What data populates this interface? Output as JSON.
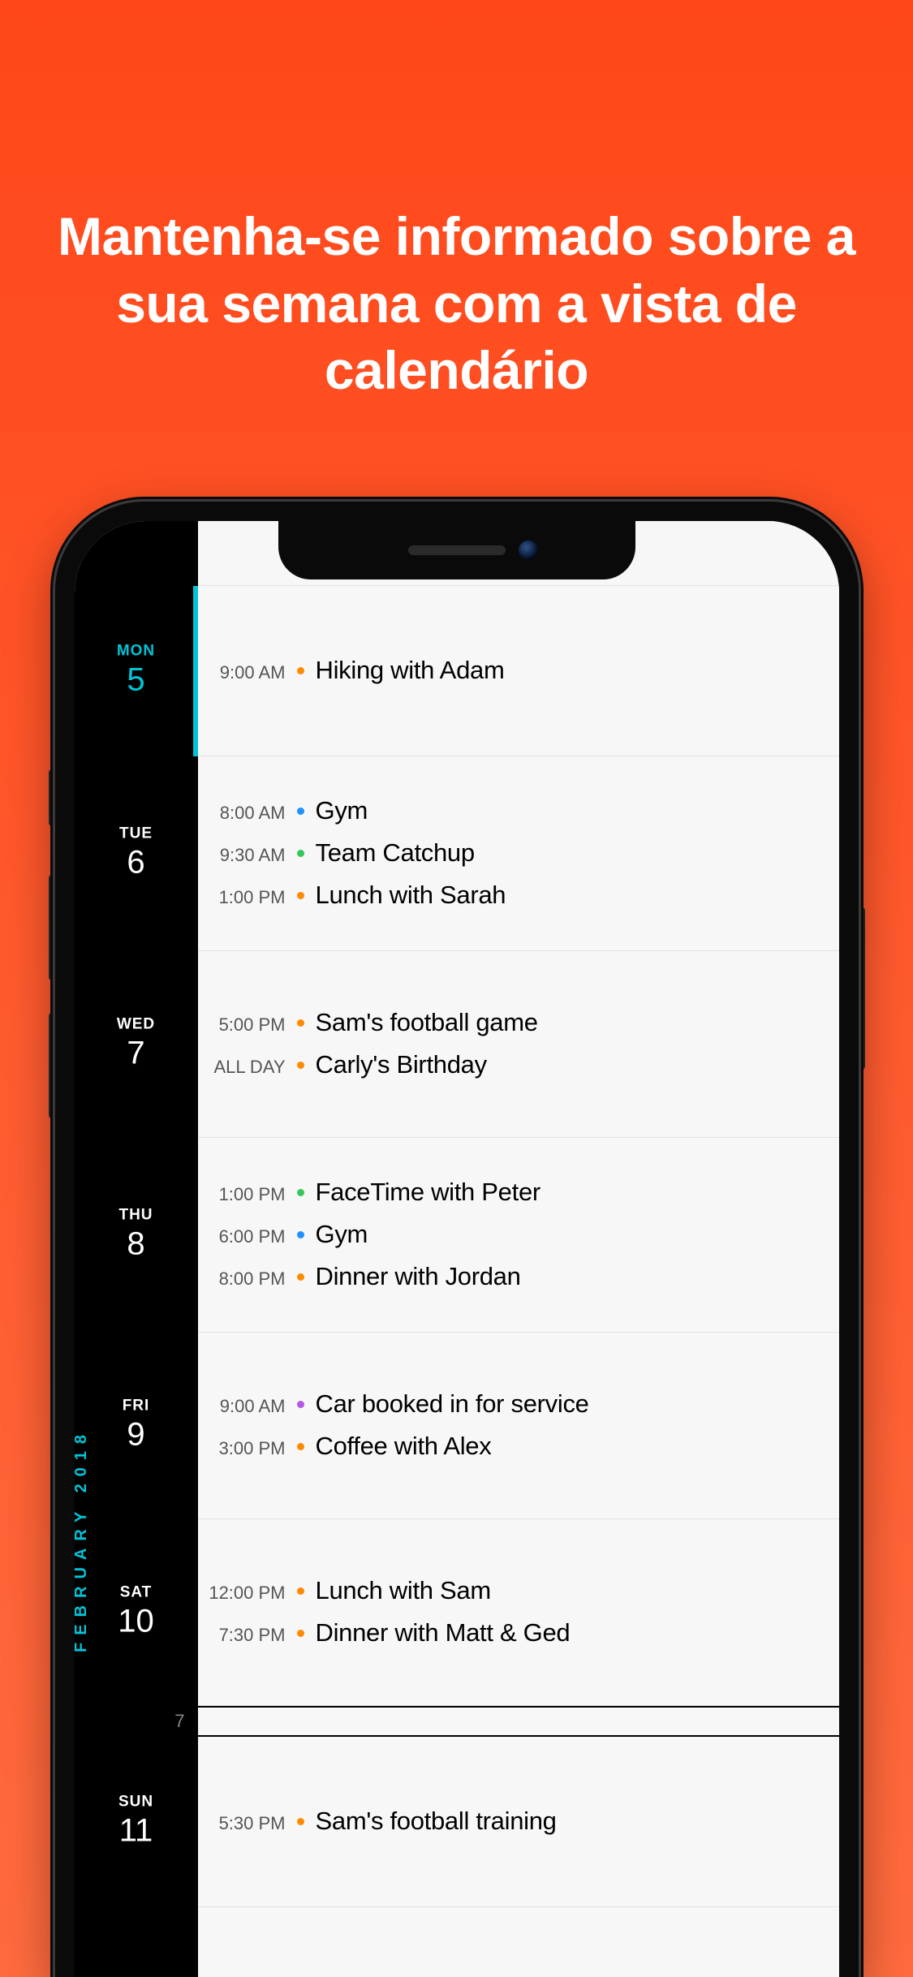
{
  "hero": "Mantenha-se informado sobre a sua semana com a vista de calendário",
  "month_label": "FEBRUARY 2018",
  "week_number_below": "7",
  "dot_colors": {
    "orange": "orange",
    "blue": "blue",
    "green": "green",
    "purple": "purple"
  },
  "days": [
    {
      "dow": "MON",
      "num": "5",
      "highlight": true,
      "events": [
        {
          "time": "9:00 AM",
          "color": "orange",
          "title": "Hiking with Adam"
        }
      ]
    },
    {
      "dow": "TUE",
      "num": "6",
      "highlight": false,
      "events": [
        {
          "time": "8:00 AM",
          "color": "blue",
          "title": "Gym"
        },
        {
          "time": "9:30 AM",
          "color": "green",
          "title": "Team Catchup"
        },
        {
          "time": "1:00 PM",
          "color": "orange",
          "title": "Lunch with Sarah"
        }
      ]
    },
    {
      "dow": "WED",
      "num": "7",
      "highlight": false,
      "events": [
        {
          "time": "5:00 PM",
          "color": "orange",
          "title": "Sam's football game"
        },
        {
          "time": "ALL DAY",
          "color": "orange",
          "title": "Carly's Birthday"
        }
      ]
    },
    {
      "dow": "THU",
      "num": "8",
      "highlight": false,
      "events": [
        {
          "time": "1:00 PM",
          "color": "green",
          "title": "FaceTime with Peter"
        },
        {
          "time": "6:00 PM",
          "color": "blue",
          "title": "Gym"
        },
        {
          "time": "8:00 PM",
          "color": "orange",
          "title": "Dinner with Jordan"
        }
      ]
    },
    {
      "dow": "FRI",
      "num": "9",
      "highlight": false,
      "events": [
        {
          "time": "9:00 AM",
          "color": "purple",
          "title": "Car booked in for service"
        },
        {
          "time": "3:00 PM",
          "color": "orange",
          "title": "Coffee with Alex"
        }
      ]
    },
    {
      "dow": "SAT",
      "num": "10",
      "highlight": false,
      "events": [
        {
          "time": "12:00 PM",
          "color": "orange",
          "title": "Lunch with Sam"
        },
        {
          "time": "7:30 PM",
          "color": "orange",
          "title": "Dinner with Matt & Ged"
        }
      ]
    },
    {
      "dow": "SUN",
      "num": "11",
      "highlight": false,
      "after_divider": true,
      "events": [
        {
          "time": "5:30 PM",
          "color": "orange",
          "title": "Sam's football training"
        }
      ]
    }
  ]
}
